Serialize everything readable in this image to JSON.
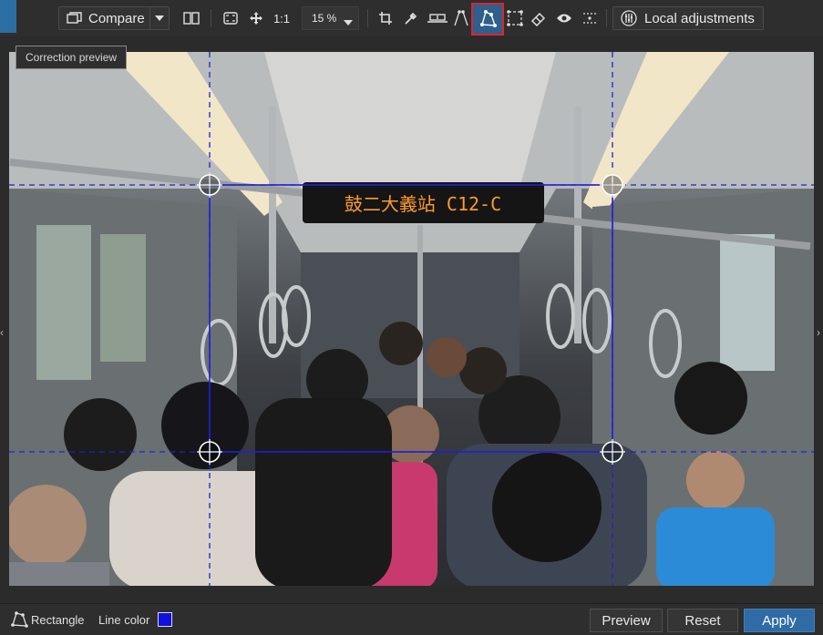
{
  "toolbar": {
    "compare_label": "Compare",
    "zoom_one_to_one": "1:1",
    "zoom_value": "15 %",
    "local_adjustments_label": "Local adjustments",
    "icons": [
      "compare-icon",
      "dropdown-arrow-icon",
      "split-view-icon",
      "fit-screen-icon",
      "pan-icon",
      "crop-icon",
      "eyedropper-icon",
      "level-icon",
      "line-perspective-icon",
      "shape-perspective-icon",
      "rectangle-perspective-icon",
      "eraser-icon",
      "eye-icon",
      "grid-icon",
      "local-adjustments-icon"
    ]
  },
  "tooltip": {
    "text": "Correction preview"
  },
  "photo": {
    "sign_text": "鼓二大義站 C12-C"
  },
  "bottombar": {
    "tool_label": "Rectangle",
    "line_color_label": "Line color",
    "line_color": "#1010e0",
    "preview_label": "Preview",
    "reset_label": "Reset",
    "apply_label": "Apply"
  },
  "colors": {
    "accent": "#2f6ca5",
    "highlight_border": "#e0232a",
    "guide_line": "#1a1ad0"
  }
}
